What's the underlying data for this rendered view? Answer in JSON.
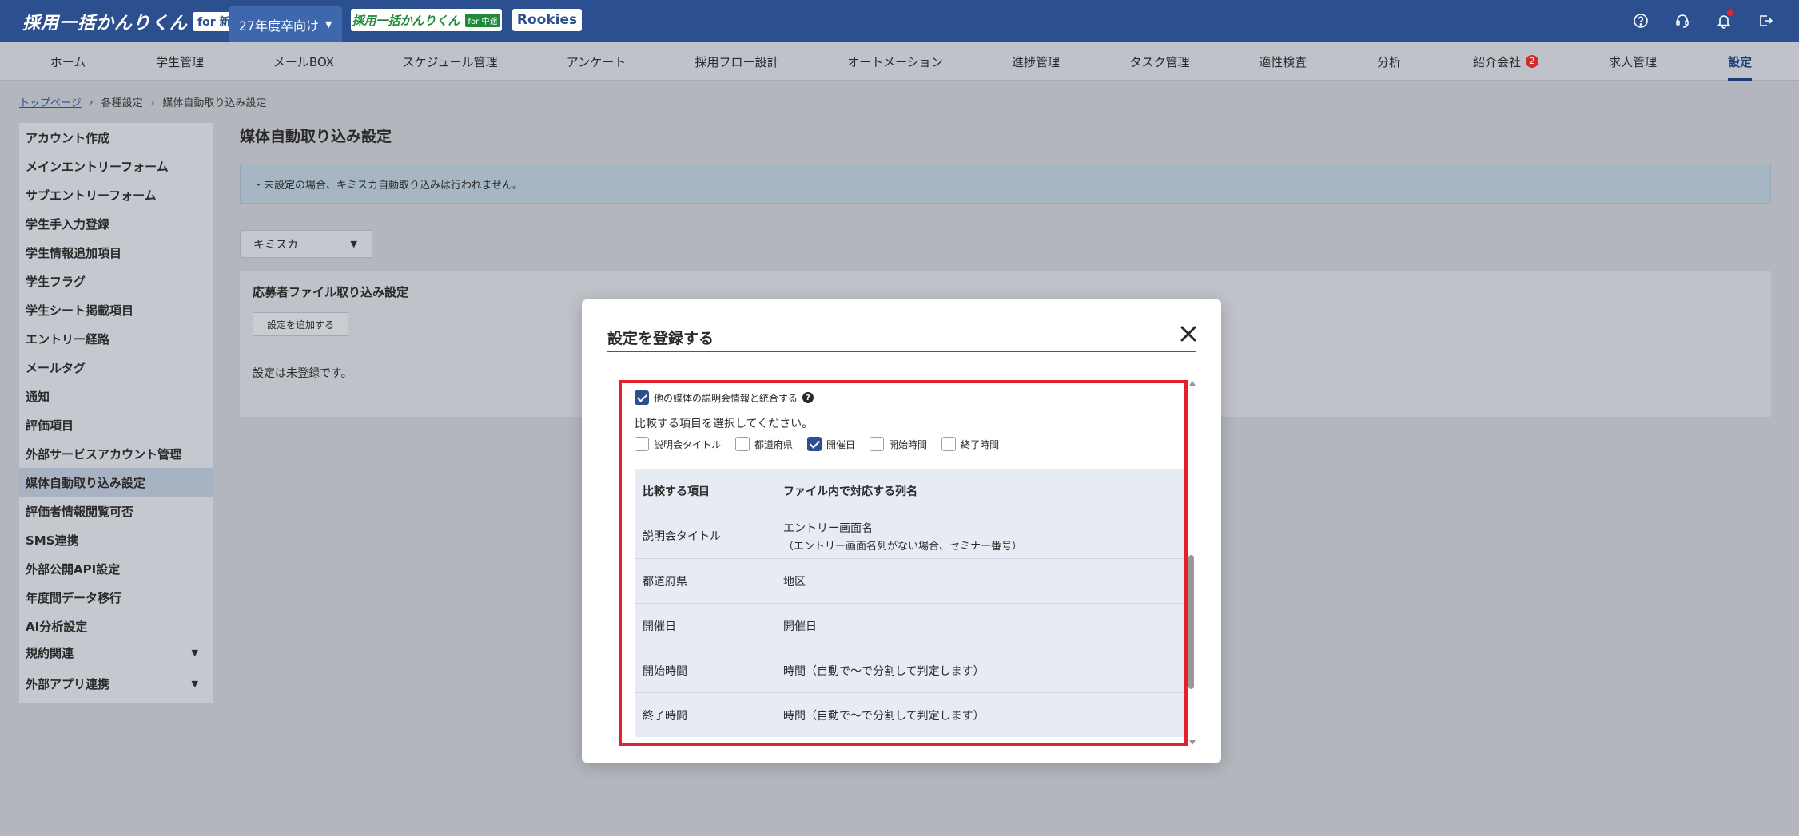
{
  "header": {
    "logo_text": "採用一括かんりくん",
    "logo_badge": "for 新卒",
    "year_select": "27年度卒向け",
    "chuto_tab": "採用一括かんりくん",
    "chuto_badge": "for 中途",
    "rookies_tab": "Rookies",
    "icons": [
      "help-icon",
      "support-icon",
      "bell-icon",
      "logout-icon"
    ],
    "brand_color": "#2b4f8f"
  },
  "nav": {
    "items": [
      "ホーム",
      "学生管理",
      "メールBOX",
      "スケジュール管理",
      "アンケート",
      "採用フロー設計",
      "オートメーション",
      "進捗管理",
      "タスク管理",
      "適性検査",
      "分析",
      "紹介会社",
      "求人管理",
      "設定"
    ],
    "agency_count": "2",
    "active": "設定"
  },
  "breadcrumb": {
    "top": "トップページ",
    "settings": "各種設定",
    "current": "媒体自動取り込み設定"
  },
  "sidebar": {
    "items": [
      "アカウント作成",
      "メインエントリーフォーム",
      "サブエントリーフォーム",
      "学生手入力登録",
      "学生情報追加項目",
      "学生フラグ",
      "学生シート掲載項目",
      "エントリー経路",
      "メールタグ",
      "通知",
      "評価項目",
      "外部サービスアカウント管理",
      "媒体自動取り込み設定",
      "評価者情報閲覧可否",
      "SMS連携",
      "外部公開API設定",
      "年度間データ移行",
      "AI分析設定",
      "規約関連",
      "外部アプリ連携"
    ],
    "active": "媒体自動取り込み設定"
  },
  "main": {
    "title": "媒体自動取り込み設定",
    "notice": "・未設定の場合、キミスカ自動取り込みは行われません。",
    "media_select": "キミスカ",
    "card_title": "応募者ファイル取り込み設定",
    "add_button": "設定を追加する",
    "empty_text": "設定は未登録です。"
  },
  "modal": {
    "title": "設定を登録する",
    "merge_label": "他の媒体の説明会情報と統合する",
    "merge_checked": true,
    "compare_prompt": "比較する項目を選択してください。",
    "options": [
      {
        "label": "説明会タイトル",
        "checked": false
      },
      {
        "label": "都道府県",
        "checked": false
      },
      {
        "label": "開催日",
        "checked": true
      },
      {
        "label": "開始時間",
        "checked": false
      },
      {
        "label": "終了時間",
        "checked": false
      }
    ],
    "table": {
      "headers": [
        "比較する項目",
        "ファイル内で対応する列名"
      ],
      "rows": [
        {
          "item": "説明会タイトル",
          "column": "エントリー画面名",
          "note": "（エントリー画面名列がない場合、セミナー番号）"
        },
        {
          "item": "都道府県",
          "column": "地区",
          "note": ""
        },
        {
          "item": "開催日",
          "column": "開催日",
          "note": ""
        },
        {
          "item": "開始時間",
          "column": "時間（自動で〜で分割して判定します）",
          "note": ""
        },
        {
          "item": "終了時間",
          "column": "時間（自動で〜で分割して判定します）",
          "note": ""
        }
      ]
    },
    "highlight_color": "#e3202e"
  }
}
